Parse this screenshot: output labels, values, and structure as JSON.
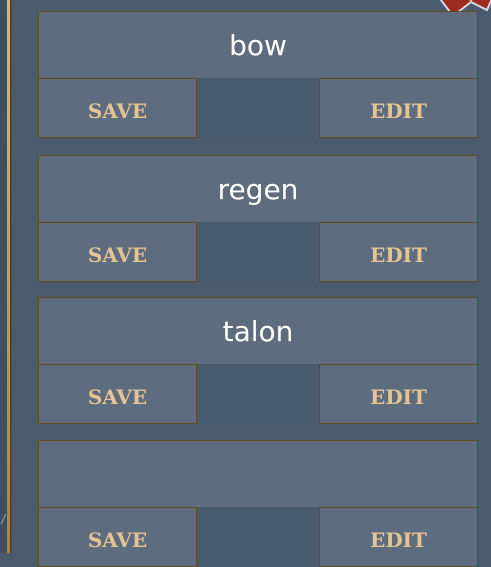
{
  "frame": {
    "left_mark": "/"
  },
  "slots": [
    {
      "name": "bow",
      "save_label": "Save",
      "edit_label": "Edit"
    },
    {
      "name": "regen",
      "save_label": "Save",
      "edit_label": "Edit"
    },
    {
      "name": "talon",
      "save_label": "Save",
      "edit_label": "Edit"
    },
    {
      "name": "",
      "save_label": "Save",
      "edit_label": "Edit"
    }
  ],
  "colors": {
    "panel": "#5d6c7f",
    "background": "#4a5b6d",
    "border": "#5f4d1e",
    "button_text": "#e6c491",
    "name_text": "#ffffff"
  },
  "icons": {
    "corner": "ornament-icon"
  }
}
